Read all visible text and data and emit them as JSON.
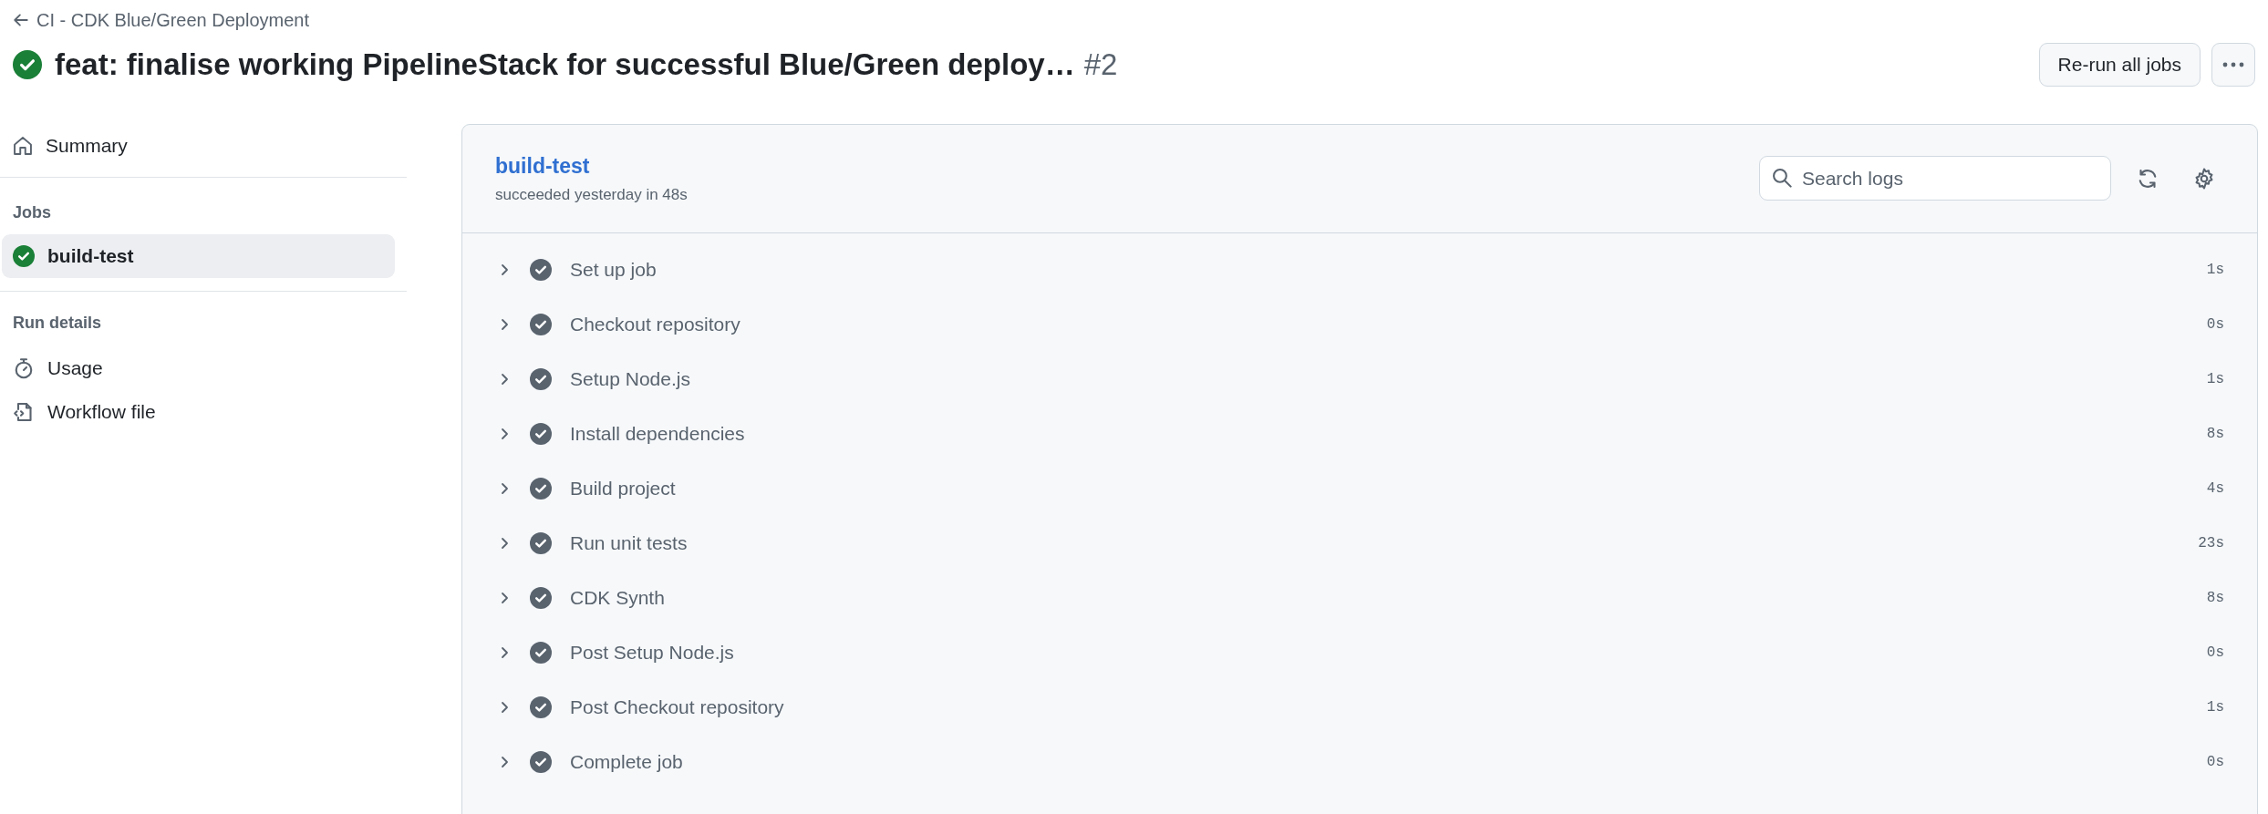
{
  "breadcrumb": "CI - CDK Blue/Green Deployment",
  "run": {
    "succeeded": true,
    "title": "feat: finalise working PipelineStack for successful Blue/Green deploy…",
    "number": "#2"
  },
  "actions": {
    "rerun": "Re-run all jobs"
  },
  "sidebar": {
    "summary": {
      "label": "Summary"
    },
    "jobs_heading": "Jobs",
    "jobs": [
      {
        "label": "build-test",
        "succeeded": true,
        "selected": true
      }
    ],
    "details_heading": "Run details",
    "details": [
      {
        "kind": "usage",
        "label": "Usage"
      },
      {
        "kind": "workflow",
        "label": "Workflow file"
      }
    ]
  },
  "job": {
    "name": "build-test",
    "subtitle": "succeeded yesterday in 48s",
    "search": {
      "placeholder": "Search logs"
    },
    "steps": [
      {
        "name": "Set up job",
        "succeeded": true,
        "duration": "1s"
      },
      {
        "name": "Checkout repository",
        "succeeded": true,
        "duration": "0s"
      },
      {
        "name": "Setup Node.js",
        "succeeded": true,
        "duration": "1s"
      },
      {
        "name": "Install dependencies",
        "succeeded": true,
        "duration": "8s"
      },
      {
        "name": "Build project",
        "succeeded": true,
        "duration": "4s"
      },
      {
        "name": "Run unit tests",
        "succeeded": true,
        "duration": "23s"
      },
      {
        "name": "CDK Synth",
        "succeeded": true,
        "duration": "8s"
      },
      {
        "name": "Post Setup Node.js",
        "succeeded": true,
        "duration": "0s"
      },
      {
        "name": "Post Checkout repository",
        "succeeded": true,
        "duration": "1s"
      },
      {
        "name": "Complete job",
        "succeeded": true,
        "duration": "0s"
      }
    ]
  }
}
